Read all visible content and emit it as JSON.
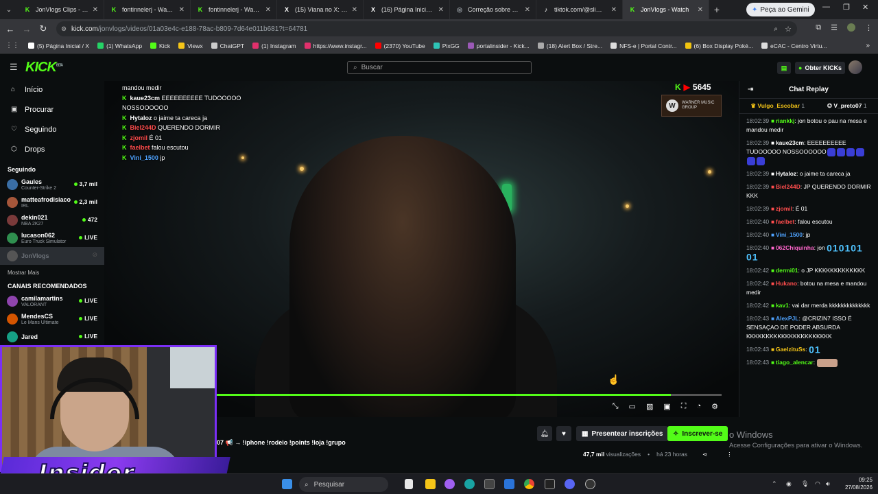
{
  "browser": {
    "tabs": [
      {
        "label": "JonVlogs Clips - Watc",
        "color": "#53fc18",
        "glyph": "K"
      },
      {
        "label": "fontinnelerj - Watch c",
        "color": "#53fc18",
        "glyph": "K"
      },
      {
        "label": "fontinnelerj - Watch c",
        "color": "#53fc18",
        "glyph": "K"
      },
      {
        "label": "(15) Viana no X: \"Mex",
        "color": "#ffffff",
        "glyph": "X"
      },
      {
        "label": "(16) Página Inicial / X",
        "color": "#ffffff",
        "glyph": "X"
      },
      {
        "label": "Correção sobre JonVl",
        "color": "#9aa0a6",
        "glyph": "◎"
      },
      {
        "label": "tiktok.com/@slimgust",
        "color": "#ffffff",
        "glyph": "♪"
      },
      {
        "label": "JonVlogs - Watch",
        "color": "#53fc18",
        "glyph": "K"
      }
    ],
    "gemini_button": "Peça ao Gemini",
    "url_host": "kick.com",
    "url_path": "/jonvlogs/videos/01a03e4c-e188-78ac-b809-7d64e011b681?t=64781",
    "bookmarks": [
      {
        "label": "(5) Página Inicial / X",
        "color": "#ffffff"
      },
      {
        "label": "(1) WhatsApp",
        "color": "#25d366"
      },
      {
        "label": "Kick",
        "color": "#53fc18"
      },
      {
        "label": "Viewx",
        "color": "#f5c518"
      },
      {
        "label": "ChatGPT",
        "color": "#cccccc"
      },
      {
        "label": "(1) Instagram",
        "color": "#e1306c"
      },
      {
        "label": "https://www.instagr...",
        "color": "#e1306c"
      },
      {
        "label": "(2370) YouTube",
        "color": "#ff0000"
      },
      {
        "label": "PixGG",
        "color": "#2ec4b6"
      },
      {
        "label": "portalinsider - Kick...",
        "color": "#9b59b6"
      },
      {
        "label": "(18) Alert Box / Stre...",
        "color": "#aaaaaa"
      },
      {
        "label": "NFS-e | Portal Contr...",
        "color": "#dddddd"
      },
      {
        "label": "(6) Box Display Poké...",
        "color": "#f1c40f"
      },
      {
        "label": "eCAC - Centro Virtu...",
        "color": "#dddddd"
      }
    ]
  },
  "kick": {
    "logo": "KICK",
    "logo_beta": "BETA",
    "search_placeholder": "Buscar",
    "get_kicks": "Obter KICKs",
    "nav": [
      {
        "label": "Início",
        "icon": "⌂"
      },
      {
        "label": "Procurar",
        "icon": "▣"
      },
      {
        "label": "Seguindo",
        "icon": "♡"
      },
      {
        "label": "Drops",
        "icon": "⬡"
      }
    ],
    "following_title": "Seguindo",
    "following": [
      {
        "name": "Gaules",
        "category": "Counter-Strike 2",
        "viewers": "3,7 mil",
        "avatar": "#3a6ea5"
      },
      {
        "name": "matteafrodisiaco",
        "category": "IRL",
        "viewers": "2,3 mil",
        "avatar": "#a5563a"
      },
      {
        "name": "dekin021",
        "category": "NBA 2K27",
        "viewers": "472",
        "avatar": "#7a3a3a"
      },
      {
        "name": "lucason062",
        "category": "Euro Truck Simulator",
        "viewers": "LIVE",
        "avatar": "#2f8f4f"
      },
      {
        "name": "JonVlogs",
        "category": "",
        "viewers": "",
        "avatar": "#555555"
      }
    ],
    "show_more": "Mostrar Mais",
    "recommended_title": "CANAIS RECOMENDADOS",
    "recommended": [
      {
        "name": "camilamartins",
        "category": "VALORANT",
        "viewers": "LIVE",
        "avatar": "#8e44ad"
      },
      {
        "name": "MendesCS",
        "category": "Le Mans Ultimate",
        "viewers": "LIVE",
        "avatar": "#d35400"
      },
      {
        "name": "Jared",
        "category": "",
        "viewers": "LIVE",
        "avatar": "#16a085"
      }
    ]
  },
  "video": {
    "viewers": "5645",
    "sponsor": "WARNER MUSIC GROUP",
    "progress": 0.9,
    "overlay_chat": [
      {
        "user": "",
        "text": "mandou medir",
        "color": "#ffffff"
      },
      {
        "user": "kaue23cm",
        "text": "EEEEEEEEEE TUDOOOOO NOSSOOOOOO",
        "color": "#ffffff"
      },
      {
        "user": "Hytaloz",
        "text": "o jaime ta careca ja",
        "color": "#ffffff"
      },
      {
        "user": "Biel244D",
        "text": "QUERENDO DORMIR",
        "color": "#ff4d4d"
      },
      {
        "user": "zjomil",
        "text": "É 01",
        "color": "#ff4d4d"
      },
      {
        "user": "faelbet",
        "text": "falou escutou",
        "color": "#ff4d4d"
      },
      {
        "user": "Vini_1500",
        "text": "jp",
        "color": "#4fa3ff"
      }
    ]
  },
  "chat": {
    "title": "Chat Replay",
    "gifter1": "Vulgo_Escobar",
    "gifter1_count": "1",
    "gifter2": "V_preto07",
    "gifter2_count": "1",
    "messages": [
      {
        "time": "18:02:39",
        "user": "riankkj",
        "color": "#53fc18",
        "text": "jon botou o pau na mesa e mandou medir",
        "big": ""
      },
      {
        "time": "18:02:39",
        "user": "kaue23cm",
        "color": "#ffffff",
        "text": "EEEEEEEEEE TUDOOOOO NOSSOOOOOO",
        "big": ""
      },
      {
        "time": "18:02:39",
        "user": "Hytaloz",
        "color": "#ffffff",
        "text": "o jaime ta careca ja",
        "big": ""
      },
      {
        "time": "18:02:39",
        "user": "Biel244D",
        "color": "#ff4d4d",
        "text": "JP QUERENDO DORMIR KKK",
        "big": ""
      },
      {
        "time": "18:02:39",
        "user": "zjomil",
        "color": "#ff4d4d",
        "text": "É 01",
        "big": ""
      },
      {
        "time": "18:02:40",
        "user": "faelbet",
        "color": "#ff4d4d",
        "text": "falou escutou",
        "big": ""
      },
      {
        "time": "18:02:40",
        "user": "Vini_1500",
        "color": "#4fa3ff",
        "text": "jp",
        "big": ""
      },
      {
        "time": "18:02:40",
        "user": "062Chiquinha",
        "color": "#ff66cc",
        "text": "jon",
        "big": "010101 01"
      },
      {
        "time": "18:02:42",
        "user": "dermi01",
        "color": "#53fc18",
        "text": "o JP KKKKKKKKKKKKK",
        "big": ""
      },
      {
        "time": "18:02:42",
        "user": "Hukano",
        "color": "#ff4d4d",
        "text": "botou na mesa e mandou medir",
        "big": ""
      },
      {
        "time": "18:02:42",
        "user": "kav1",
        "color": "#53fc18",
        "text": "vai dar merda kkkkkkkkkkkkkk",
        "big": ""
      },
      {
        "time": "18:02:43",
        "user": "AlexPJL",
        "color": "#4fa3ff",
        "text": "@CRIZIN7 ISSO É SENSAÇAO DE PODER ABSURDA KKKKKKKKKKKKKKKKKKKKKK",
        "big": ""
      },
      {
        "time": "18:02:43",
        "user": "GaelzituSs",
        "color": "#f5c518",
        "text": "",
        "big": "01"
      },
      {
        "time": "18:02:43",
        "user": "tiago_alencar",
        "color": "#53fc18",
        "text": "",
        "big": ""
      }
    ]
  },
  "below": {
    "title": "07 📢 → !iphone !rodeio !points !loja !grupo",
    "gift_subs": "Presentear inscrições",
    "subscribe": "Inscrever-se",
    "views": "47,7 mil",
    "views_label": "visualizações",
    "age": "há 23 horas"
  },
  "windows": {
    "activate_title": "o Windows",
    "activate_sub": "Acesse Configurações para ativar o Windows.",
    "search": "Pesquisar",
    "time": "09:25",
    "date": "27/08/2026"
  },
  "overlay": {
    "brand": "Insider"
  }
}
